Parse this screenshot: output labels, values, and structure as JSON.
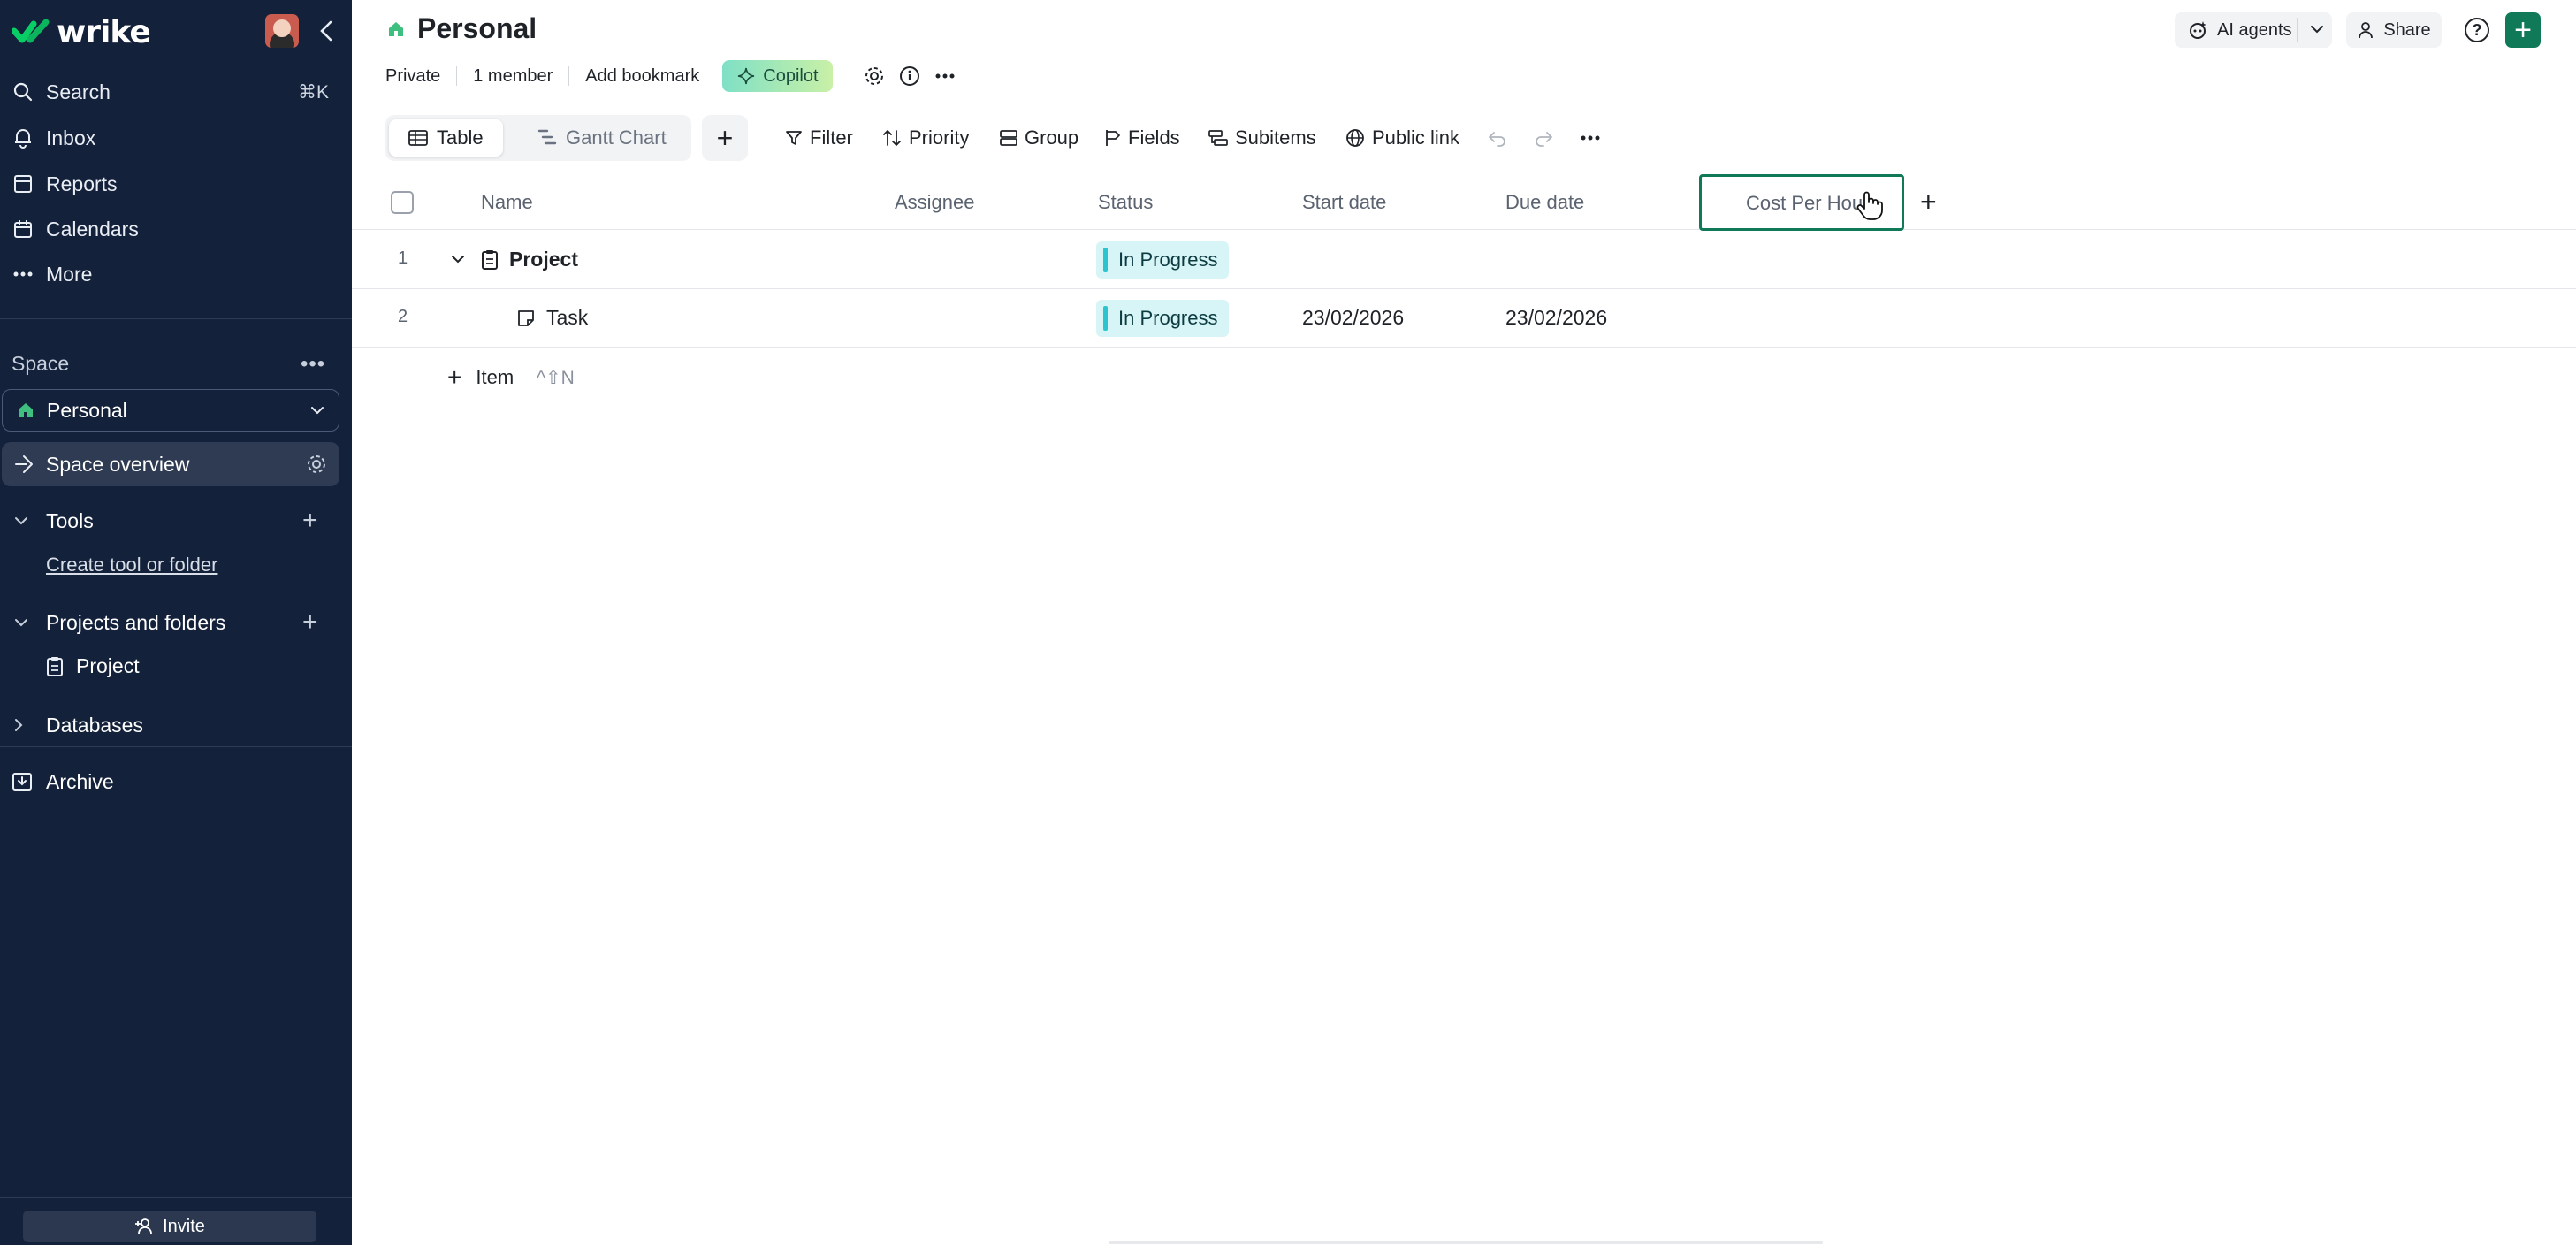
{
  "sidebar": {
    "logo_text": "wrike",
    "nav": [
      {
        "label": "Search",
        "shortcut": "⌘K",
        "icon": "search-icon"
      },
      {
        "label": "Inbox",
        "icon": "bell-icon"
      },
      {
        "label": "Reports",
        "icon": "reports-icon"
      },
      {
        "label": "Calendars",
        "icon": "calendar-icon"
      },
      {
        "label": "More",
        "icon": "more-dots-icon"
      }
    ],
    "space_label": "Space",
    "space_select": "Personal",
    "space_overview": "Space overview",
    "tools_label": "Tools",
    "create_tool": "Create tool or folder",
    "projects_label": "Projects and folders",
    "project_item": "Project",
    "databases_label": "Databases",
    "archive_label": "Archive",
    "invite_label": "Invite"
  },
  "header": {
    "title": "Personal",
    "meta": [
      "Private",
      "1 member",
      "Add bookmark"
    ],
    "copilot_label": "Copilot",
    "ai_agents_label": "AI agents",
    "share_label": "Share",
    "help_glyph": "?"
  },
  "toolbar": {
    "views": [
      {
        "label": "Table",
        "active": true
      },
      {
        "label": "Gantt Chart",
        "active": false
      }
    ],
    "tools": [
      "Filter",
      "Priority",
      "Group",
      "Fields",
      "Subitems",
      "Public link"
    ]
  },
  "table": {
    "columns": [
      "Name",
      "Assignee",
      "Status",
      "Start date",
      "Due date",
      "Cost Per Hour"
    ],
    "rows": [
      {
        "num": "1",
        "name": "Project",
        "status": "In Progress",
        "start": "",
        "due": "",
        "type": "project"
      },
      {
        "num": "2",
        "name": "Task",
        "status": "In Progress",
        "start": "23/02/2026",
        "due": "23/02/2026",
        "type": "task"
      }
    ],
    "add_item_label": "Item",
    "add_item_shortcut": "^⇧N"
  },
  "colors": {
    "sidebar_bg": "#14213a",
    "accent": "#107a58",
    "status_bg": "#d7f4f6",
    "status_bar": "#2ec4cf"
  }
}
